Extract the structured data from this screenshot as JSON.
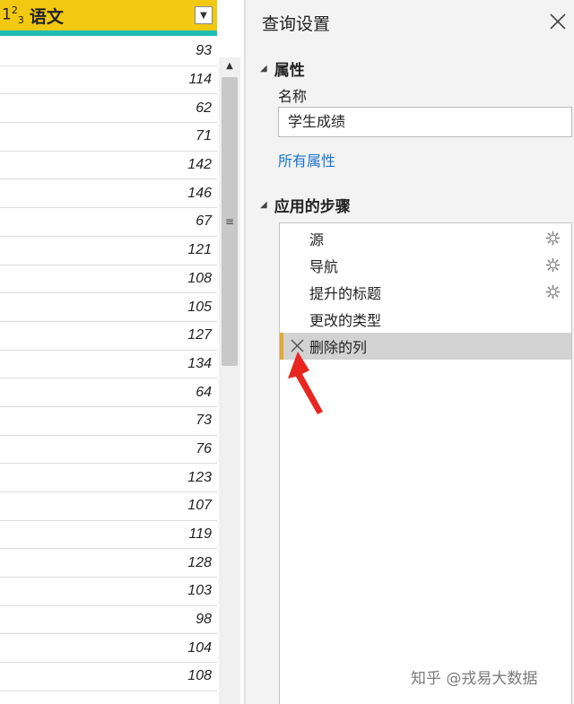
{
  "table": {
    "column_type_icon": "1²₃",
    "column_title": "语文",
    "dropdown_icon": "chevron-down-icon",
    "values": [
      "93",
      "114",
      "62",
      "71",
      "142",
      "146",
      "67",
      "121",
      "108",
      "105",
      "127",
      "134",
      "64",
      "73",
      "76",
      "123",
      "107",
      "119",
      "128",
      "103",
      "98",
      "104",
      "108"
    ]
  },
  "settings": {
    "title": "查询设置",
    "properties_heading": "属性",
    "name_label": "名称",
    "name_value": "学生成绩",
    "all_properties_link": "所有属性",
    "steps_heading": "应用的步骤",
    "steps": [
      {
        "label": "源",
        "has_gear": true
      },
      {
        "label": "导航",
        "has_gear": true
      },
      {
        "label": "提升的标题",
        "has_gear": true
      },
      {
        "label": "更改的类型",
        "has_gear": false
      },
      {
        "label": "删除的列",
        "has_gear": false,
        "selected": true
      }
    ]
  },
  "watermark": "知乎 @戎易大数据",
  "colors": {
    "header": "#f2c811",
    "quality_bar": "#1fbcb4",
    "link": "#1a73c7",
    "selected_accent": "#e4a832",
    "arrow": "#e8261f"
  }
}
